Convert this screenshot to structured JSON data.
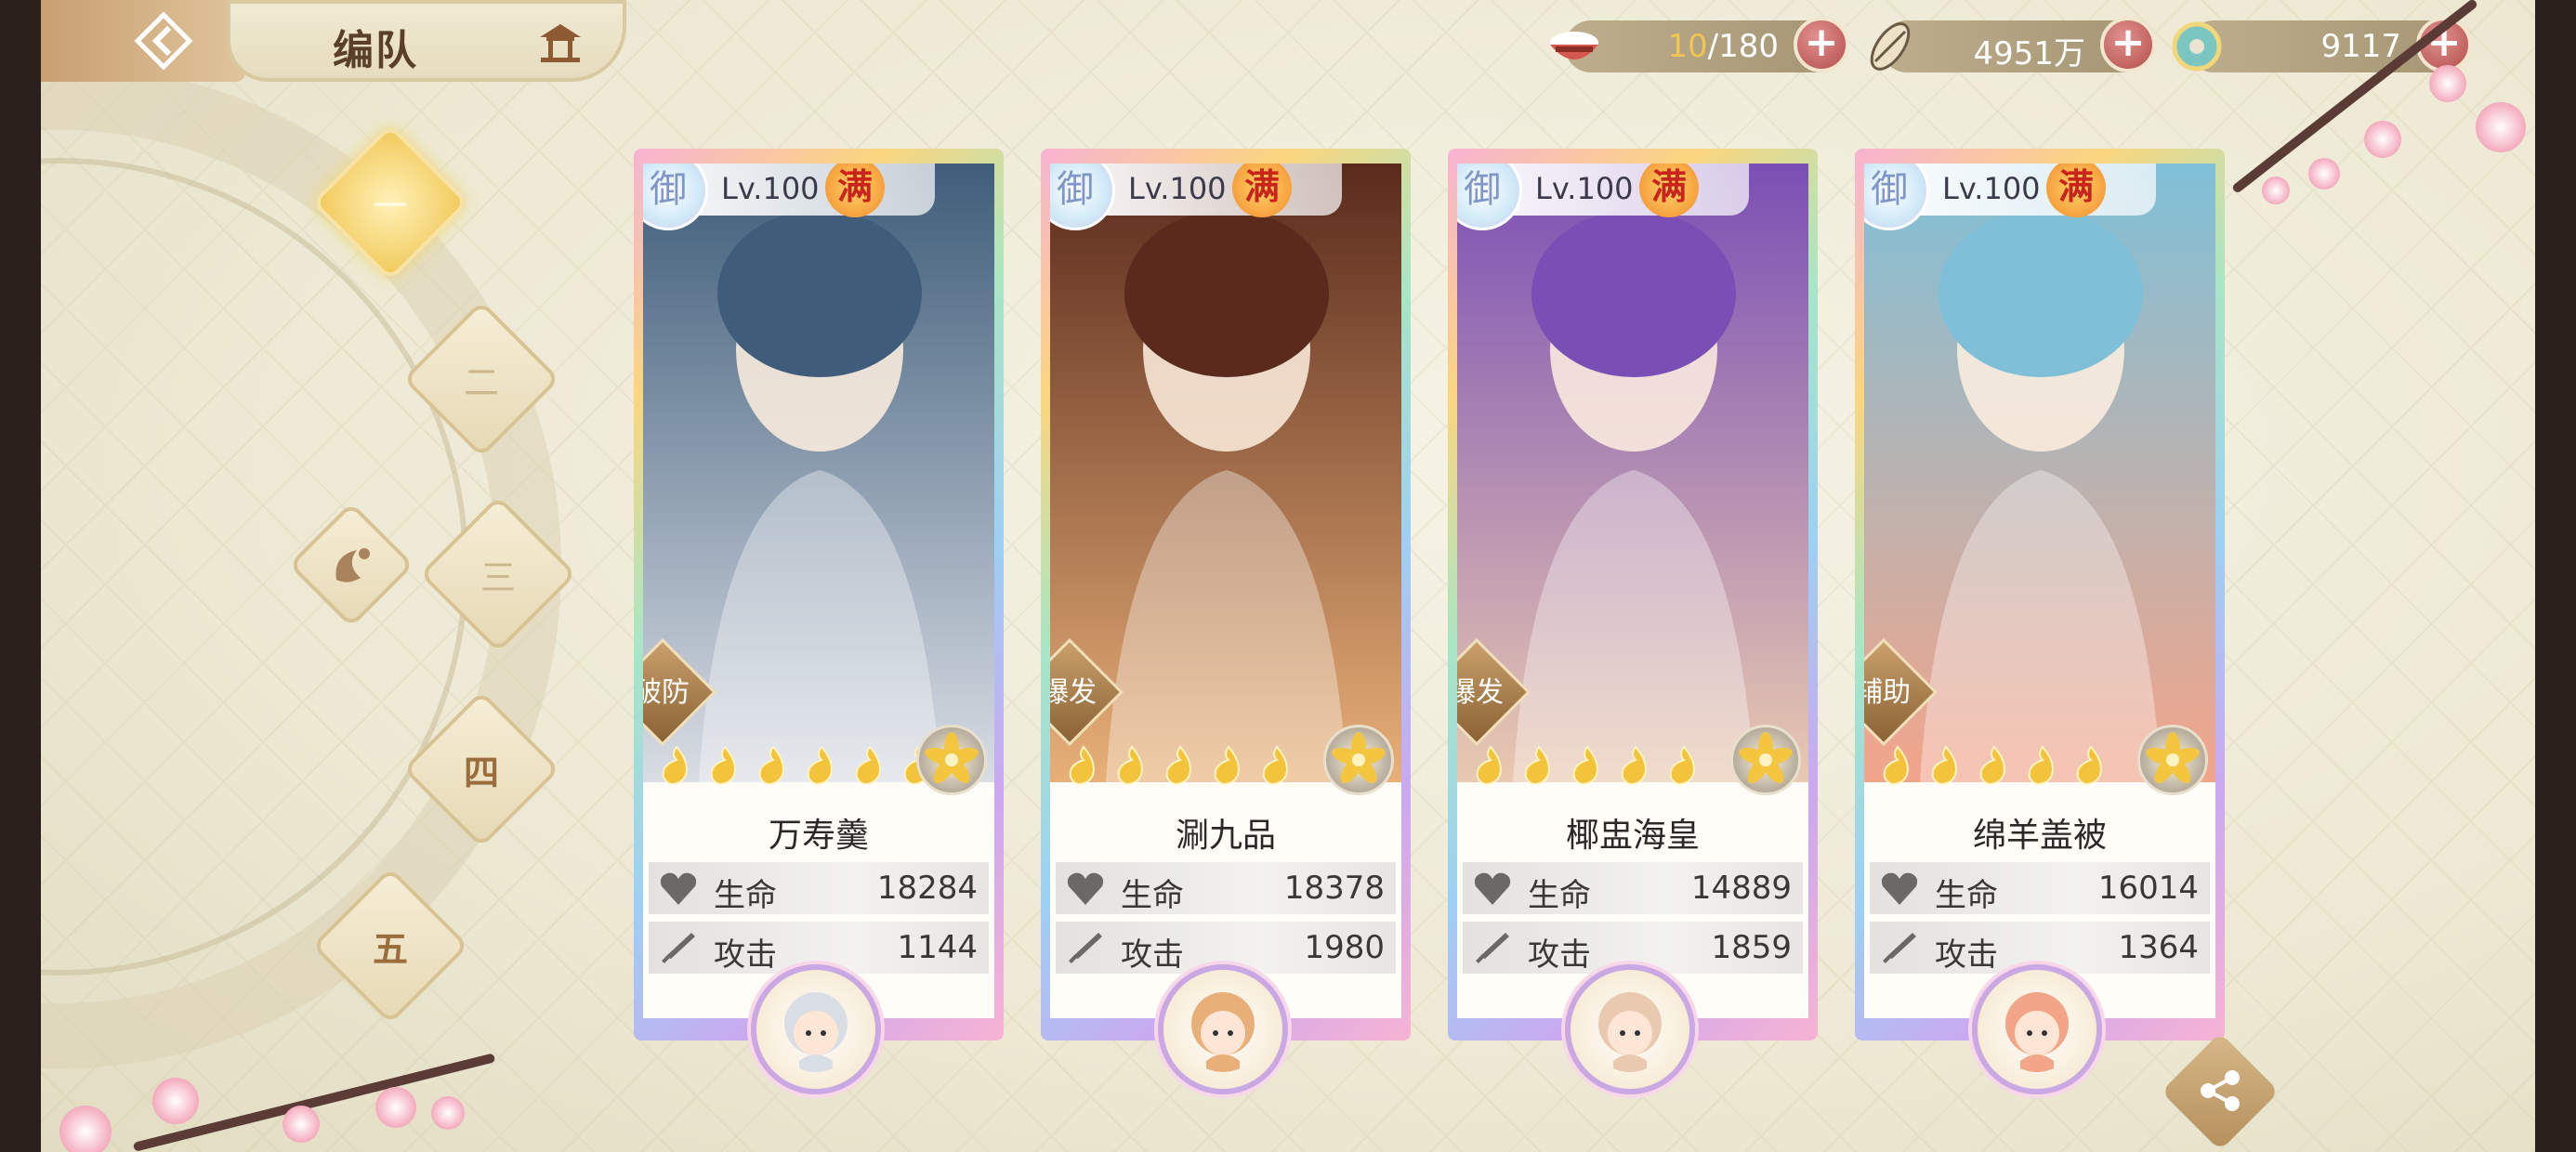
{
  "header": {
    "title": "编队",
    "back_icon": "back-arrow-icon",
    "pavilion_icon": "pavilion-icon"
  },
  "resources": [
    {
      "name": "stamina",
      "icon": "rice-bowl-icon",
      "current": "10",
      "max": "/180"
    },
    {
      "name": "coins",
      "icon": "coin-icon",
      "value": "4951万"
    },
    {
      "name": "jade",
      "icon": "jade-icon",
      "value": "9117"
    }
  ],
  "teams": [
    {
      "label": "一",
      "active": true
    },
    {
      "label": "二",
      "active": false
    },
    {
      "label": "三",
      "active": false
    },
    {
      "label": "四",
      "active": false
    },
    {
      "label": "五",
      "active": false
    }
  ],
  "cards": [
    {
      "yu": "御",
      "level": "Lv.100",
      "max_badge": "满",
      "role": "破防",
      "name": "万寿羹",
      "hp_label": "生命",
      "hp": "18284",
      "atk_label": "攻击",
      "atk": "1144",
      "stars": 6,
      "palette": [
        "#3f5d7a",
        "#d9dde4"
      ]
    },
    {
      "yu": "御",
      "level": "Lv.100",
      "max_badge": "满",
      "role": "爆发",
      "name": "涮九品",
      "hp_label": "生命",
      "hp": "18378",
      "atk_label": "攻击",
      "atk": "1980",
      "stars": 5,
      "palette": [
        "#5a2a1c",
        "#e8b078"
      ]
    },
    {
      "yu": "御",
      "level": "Lv.100",
      "max_badge": "满",
      "role": "爆发",
      "name": "椰盅海皇",
      "hp_label": "生命",
      "hp": "14889",
      "atk_label": "攻击",
      "atk": "1859",
      "stars": 5,
      "palette": [
        "#7a4fb5",
        "#e9c9b0"
      ]
    },
    {
      "yu": "御",
      "level": "Lv.100",
      "max_badge": "满",
      "role": "辅助",
      "name": "绵羊盖被",
      "hp_label": "生命",
      "hp": "16014",
      "atk_label": "攻击",
      "atk": "1364",
      "stars": 5,
      "palette": [
        "#7fc0d8",
        "#f3a58a"
      ]
    }
  ],
  "colors": {
    "accent_gold": "#f1c95a",
    "frame_pink": "#f7b3d3",
    "plus_red": "#b34e4a"
  }
}
